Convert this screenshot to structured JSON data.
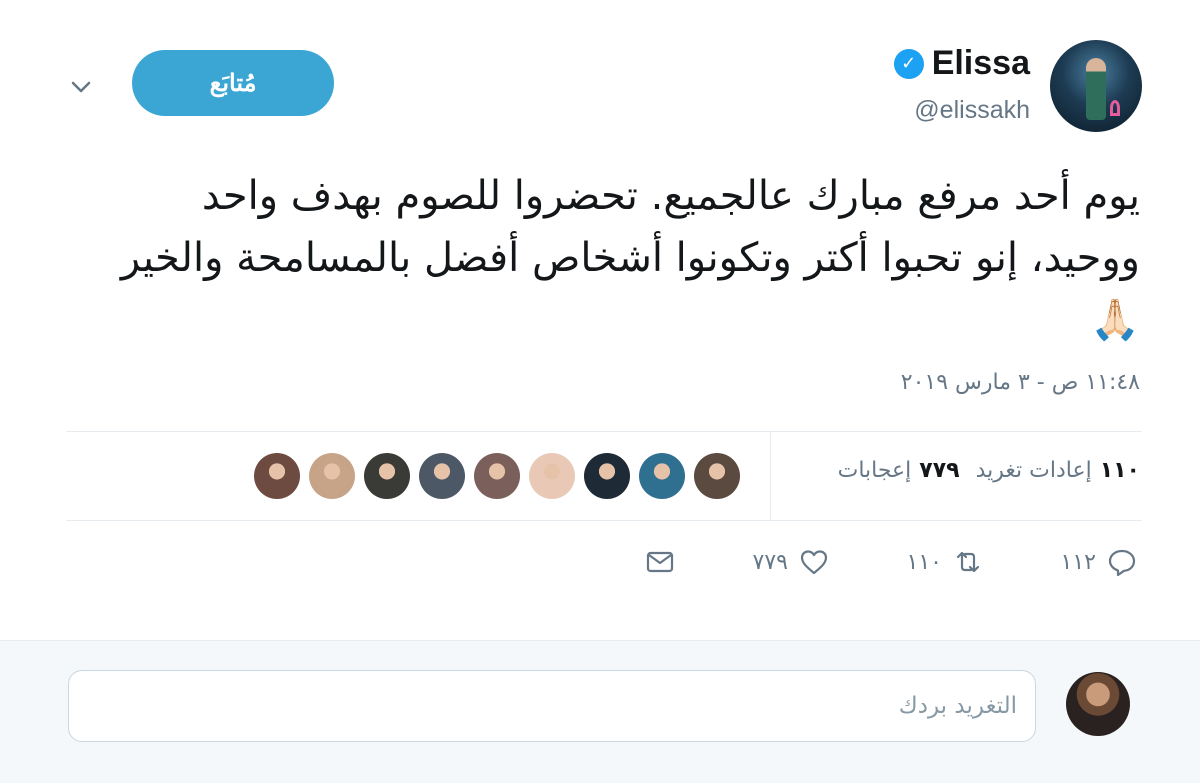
{
  "author": {
    "display_name": "Elissa",
    "handle": "@elissakh",
    "verified_icon": "verified-badge-icon",
    "avatar_icon": "avatar"
  },
  "follow_button": {
    "label": "مُتابَع"
  },
  "menu_caret_icon": "chevron-down-icon",
  "tweet": {
    "text": "يوم أحد مرفع مبارك عالجميع. تحضروا للصوم بهدف واحد ووحيد، إنو تحبوا أكتر وتكونوا أشخاص أفضل بالمسامحة والخير",
    "emoji": "🙏🏻",
    "timestamp": "١١:٤٨ ص - ٣ مارس ٢٠١٩"
  },
  "stats": {
    "retweets_count": "١١٠",
    "retweets_label": "إعادات تغريد",
    "likes_count": "٧٧٩",
    "likes_label": "إعجابات"
  },
  "likers": [
    {
      "name": "liker-1",
      "color": "#5a4a40"
    },
    {
      "name": "liker-2",
      "color": "#2f6f90"
    },
    {
      "name": "liker-3",
      "color": "#1e2a36"
    },
    {
      "name": "liker-4",
      "color": "#e9c9b6"
    },
    {
      "name": "liker-5",
      "color": "#7a5f5a"
    },
    {
      "name": "liker-6",
      "color": "#4c5866"
    },
    {
      "name": "liker-7",
      "color": "#3a3a36"
    },
    {
      "name": "liker-8",
      "color": "#c7a488"
    },
    {
      "name": "liker-9",
      "color": "#6e4b40"
    }
  ],
  "actions": {
    "reply_count": "١١٢",
    "retweet_count": "١١٠",
    "like_count": "٧٧٩"
  },
  "reply_box": {
    "placeholder": "التغريد بردك"
  },
  "colors": {
    "accent": "#3ba6d4",
    "verified": "#1da1f2",
    "muted": "#657786",
    "divider": "#e6ecf0",
    "reply_bg": "#f5f8fa"
  }
}
